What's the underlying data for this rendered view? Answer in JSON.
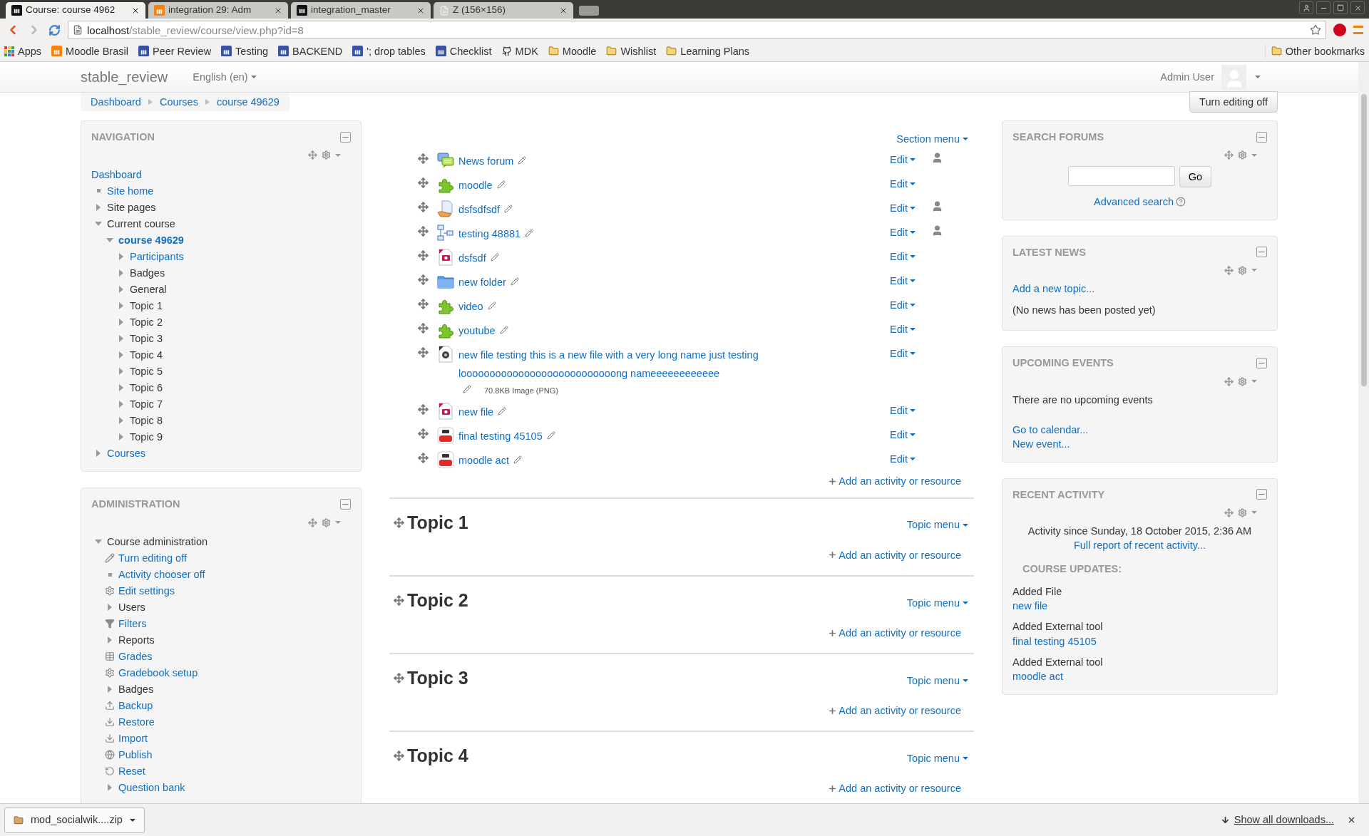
{
  "browser": {
    "tabs": [
      {
        "title": "Course: course 4962",
        "kind": "moodle",
        "selected": true
      },
      {
        "title": "integration 29: Adm",
        "kind": "moodle-orange",
        "selected": false
      },
      {
        "title": "integration_master",
        "kind": "moodle",
        "selected": false
      },
      {
        "title": "Z (156×156)",
        "kind": "page",
        "selected": false
      }
    ],
    "address": {
      "host": "localhost",
      "path": "/stable_review/course/view.php?id=8"
    },
    "bookmarks": [
      {
        "label": "Apps",
        "kind": "apps"
      },
      {
        "label": "Moodle Brasil",
        "kind": "moodle-orange"
      },
      {
        "label": "Peer Review",
        "kind": "moodle-blue"
      },
      {
        "label": "Testing",
        "kind": "moodle-blue"
      },
      {
        "label": "BACKEND",
        "kind": "moodle-blue"
      },
      {
        "label": "'; drop tables",
        "kind": "moodle-blue"
      },
      {
        "label": "Checklist",
        "kind": "moodle-blue"
      },
      {
        "label": "MDK",
        "kind": "github"
      },
      {
        "label": "Moodle",
        "kind": "folder"
      },
      {
        "label": "Wishlist",
        "kind": "folder"
      },
      {
        "label": "Learning Plans",
        "kind": "folder"
      }
    ],
    "other_bookmarks": "Other bookmarks"
  },
  "header": {
    "site_name": "stable_review",
    "language": "English (en)",
    "user": "Admin User"
  },
  "breadcrumb": [
    "Dashboard",
    "Courses",
    "course 49629"
  ],
  "editing_button": "Turn editing off",
  "navigation": {
    "title": "NAVIGATION",
    "items": [
      {
        "label": "Dashboard",
        "kind": "plain",
        "link": true
      },
      {
        "label": "Site home",
        "kind": "leaf",
        "link": true
      },
      {
        "label": "Site pages",
        "kind": "branch",
        "link": false,
        "expanded": false
      },
      {
        "label": "Current course",
        "kind": "branch",
        "link": false,
        "expanded": true,
        "children": [
          {
            "label": "course 49629",
            "kind": "branch",
            "link": true,
            "current": true,
            "expanded": true,
            "children": [
              {
                "label": "Participants",
                "kind": "branch",
                "link": true,
                "expanded": false
              },
              {
                "label": "Badges",
                "kind": "branch",
                "link": false,
                "expanded": false
              },
              {
                "label": "General",
                "kind": "branch",
                "link": false,
                "expanded": false
              },
              {
                "label": "Topic 1",
                "kind": "branch",
                "link": false,
                "expanded": false
              },
              {
                "label": "Topic 2",
                "kind": "branch",
                "link": false,
                "expanded": false
              },
              {
                "label": "Topic 3",
                "kind": "branch",
                "link": false,
                "expanded": false
              },
              {
                "label": "Topic 4",
                "kind": "branch",
                "link": false,
                "expanded": false
              },
              {
                "label": "Topic 5",
                "kind": "branch",
                "link": false,
                "expanded": false
              },
              {
                "label": "Topic 6",
                "kind": "branch",
                "link": false,
                "expanded": false
              },
              {
                "label": "Topic 7",
                "kind": "branch",
                "link": false,
                "expanded": false
              },
              {
                "label": "Topic 8",
                "kind": "branch",
                "link": false,
                "expanded": false
              },
              {
                "label": "Topic 9",
                "kind": "branch",
                "link": false,
                "expanded": false
              }
            ]
          }
        ]
      },
      {
        "label": "Courses",
        "kind": "branch",
        "link": true,
        "expanded": false
      }
    ]
  },
  "administration": {
    "title": "ADMINISTRATION",
    "items": [
      {
        "label": "Course administration",
        "kind": "branch",
        "link": false,
        "expanded": true,
        "children": [
          {
            "label": "Turn editing off",
            "kind": "edit",
            "link": true
          },
          {
            "label": "Activity chooser off",
            "kind": "leaf",
            "link": true
          },
          {
            "label": "Edit settings",
            "kind": "settings",
            "link": true
          },
          {
            "label": "Users",
            "kind": "branch",
            "link": false,
            "expanded": false
          },
          {
            "label": "Filters",
            "kind": "filter",
            "link": true
          },
          {
            "label": "Reports",
            "kind": "branch",
            "link": false,
            "expanded": false
          },
          {
            "label": "Grades",
            "kind": "grades",
            "link": true
          },
          {
            "label": "Gradebook setup",
            "kind": "settings",
            "link": true
          },
          {
            "label": "Badges",
            "kind": "branch",
            "link": false,
            "expanded": false
          },
          {
            "label": "Backup",
            "kind": "backup",
            "link": true
          },
          {
            "label": "Restore",
            "kind": "restore",
            "link": true
          },
          {
            "label": "Import",
            "kind": "restore",
            "link": true
          },
          {
            "label": "Publish",
            "kind": "publish",
            "link": true
          },
          {
            "label": "Reset",
            "kind": "reset",
            "link": true
          },
          {
            "label": "Question bank",
            "kind": "branch",
            "link": true,
            "expanded": false
          }
        ]
      }
    ]
  },
  "section_zero": {
    "menu": "Section menu",
    "add": "Add an activity or resource",
    "activities": [
      {
        "name": "News forum",
        "kind": "forum",
        "edit": "Edit",
        "restricted": true
      },
      {
        "name": "moodle",
        "kind": "external-tool",
        "edit": "Edit",
        "restricted": false
      },
      {
        "name": "dsfsdfsdf",
        "kind": "assignment",
        "edit": "Edit",
        "restricted": true
      },
      {
        "name": "testing 48881",
        "kind": "workshop",
        "edit": "Edit",
        "restricted": true
      },
      {
        "name": "dsfsdf",
        "kind": "image",
        "edit": "Edit",
        "restricted": false
      },
      {
        "name": "new folder",
        "kind": "folder",
        "edit": "Edit",
        "restricted": false
      },
      {
        "name": "video",
        "kind": "external-tool",
        "edit": "Edit",
        "restricted": false
      },
      {
        "name": "youtube",
        "kind": "external-tool",
        "edit": "Edit",
        "restricted": false
      },
      {
        "name": "new file testing this is a new file with a very long name just testing looooooooooooooooooooooooooong nameeeeeeeeeeee",
        "kind": "file",
        "edit": "Edit",
        "restricted": false,
        "details": "70.8KB Image (PNG)"
      },
      {
        "name": "new file",
        "kind": "image",
        "edit": "Edit",
        "restricted": false
      },
      {
        "name": "final testing 45105",
        "kind": "video",
        "edit": "Edit",
        "restricted": false
      },
      {
        "name": "moodle act",
        "kind": "video",
        "edit": "Edit",
        "restricted": false
      }
    ]
  },
  "topics": [
    {
      "title": "Topic 1",
      "menu": "Topic menu",
      "add": "Add an activity or resource"
    },
    {
      "title": "Topic 2",
      "menu": "Topic menu",
      "add": "Add an activity or resource"
    },
    {
      "title": "Topic 3",
      "menu": "Topic menu",
      "add": "Add an activity or resource"
    },
    {
      "title": "Topic 4",
      "menu": "Topic menu",
      "add": "Add an activity or resource"
    }
  ],
  "search_forums": {
    "title": "SEARCH FORUMS",
    "button": "Go",
    "link": "Advanced search"
  },
  "latest_news": {
    "title": "LATEST NEWS",
    "link": "Add a new topic...",
    "note": "(No news has been posted yet)"
  },
  "upcoming_events": {
    "title": "UPCOMING EVENTS",
    "note": "There are no upcoming events",
    "links": [
      "Go to calendar...",
      "New event..."
    ]
  },
  "recent_activity": {
    "title": "RECENT ACTIVITY",
    "since": "Activity since Sunday, 18 October 2015, 2:36 AM",
    "report_link": "Full report of recent activity...",
    "updates_heading": "COURSE UPDATES:",
    "updates": [
      {
        "action": "Added File",
        "link": "new file"
      },
      {
        "action": "Added External tool",
        "link": "final testing 45105"
      },
      {
        "action": "Added External tool",
        "link": "moodle act"
      }
    ]
  },
  "downloads": {
    "file": "mod_socialwik....zip",
    "show_all": "Show all downloads..."
  }
}
